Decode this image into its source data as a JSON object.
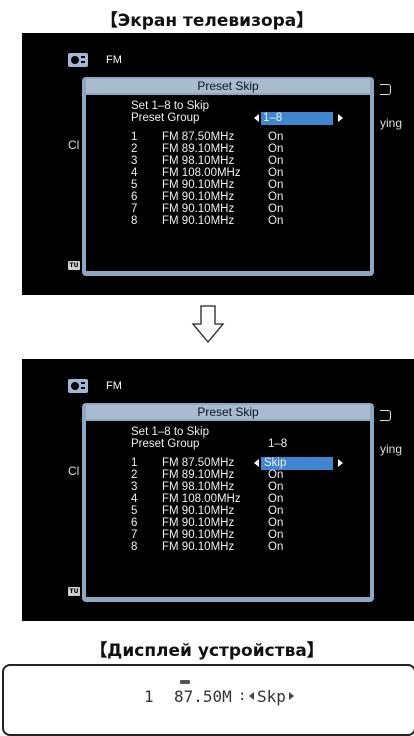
{
  "headings": {
    "tv_screen": "【Экран телевизора】",
    "device_display": "【Дисплей устройства】"
  },
  "screen_common": {
    "source": "FM",
    "bg_right_text": "ying",
    "bg_left_text": "Cl",
    "tu_badge": "TU"
  },
  "screen_before": {
    "title": "Preset Skip",
    "description": "Set 1–8 to Skip",
    "group_label": "Preset Group",
    "group_value": "1–8",
    "presets": [
      {
        "num": "1",
        "freq": "FM 87.50MHz",
        "status": "On"
      },
      {
        "num": "2",
        "freq": "FM 89.10MHz",
        "status": "On"
      },
      {
        "num": "3",
        "freq": "FM 98.10MHz",
        "status": "On"
      },
      {
        "num": "4",
        "freq": "FM 108.00MHz",
        "status": "On"
      },
      {
        "num": "5",
        "freq": "FM 90.10MHz",
        "status": "On"
      },
      {
        "num": "6",
        "freq": "FM 90.10MHz",
        "status": "On"
      },
      {
        "num": "7",
        "freq": "FM 90.10MHz",
        "status": "On"
      },
      {
        "num": "8",
        "freq": "FM 90.10MHz",
        "status": "On"
      }
    ]
  },
  "screen_after": {
    "title": "Preset Skip",
    "description": "Set 1–8 to Skip",
    "group_label": "Preset Group",
    "group_value": "1–8",
    "presets": [
      {
        "num": "1",
        "freq": "FM 87.50MHz",
        "status": "Skip"
      },
      {
        "num": "2",
        "freq": "FM 89.10MHz",
        "status": "On"
      },
      {
        "num": "3",
        "freq": "FM 98.10MHz",
        "status": "On"
      },
      {
        "num": "4",
        "freq": "FM 108.00MHz",
        "status": "On"
      },
      {
        "num": "5",
        "freq": "FM 90.10MHz",
        "status": "On"
      },
      {
        "num": "6",
        "freq": "FM 90.10MHz",
        "status": "On"
      },
      {
        "num": "7",
        "freq": "FM 90.10MHz",
        "status": "On"
      },
      {
        "num": "8",
        "freq": "FM 90.10MHz",
        "status": "On"
      }
    ]
  },
  "device_display": {
    "preset_number": "1",
    "frequency": "87.50M",
    "status": "Skp"
  },
  "colors": {
    "highlight": "#3e86d0",
    "panel_frame": "#8fa8c2",
    "screen_bg": "#000000"
  }
}
